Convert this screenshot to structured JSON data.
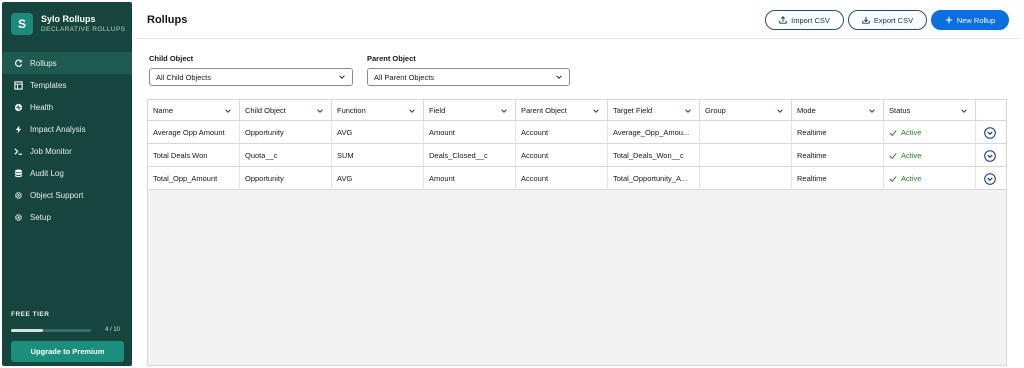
{
  "brand": {
    "logo_letter": "S",
    "name": "Sylo Rollups",
    "subtitle": "DECLARATIVE ROLLUPS"
  },
  "sidebar": {
    "items": [
      {
        "label": "Rollups",
        "icon": "refresh-icon",
        "active": true
      },
      {
        "label": "Templates",
        "icon": "template-icon",
        "active": false
      },
      {
        "label": "Health",
        "icon": "health-icon",
        "active": false
      },
      {
        "label": "Impact Analysis",
        "icon": "bolt-icon",
        "active": false
      },
      {
        "label": "Job Monitor",
        "icon": "terminal-icon",
        "active": false
      },
      {
        "label": "Audit Log",
        "icon": "database-icon",
        "active": false
      },
      {
        "label": "Object Support",
        "icon": "gear-icon",
        "active": false
      },
      {
        "label": "Setup",
        "icon": "settings-icon",
        "active": false
      }
    ],
    "tier_label": "FREE TIER",
    "tier_progress": 0.4,
    "tier_count": "4 / 10",
    "upgrade_label": "Upgrade to Premium"
  },
  "header": {
    "title": "Rollups",
    "import_label": "Import CSV",
    "export_label": "Export CSV",
    "new_label": "New Rollup"
  },
  "filters": {
    "child_label": "Child Object",
    "child_value": "All Child Objects",
    "parent_label": "Parent Object",
    "parent_value": "All Parent Objects"
  },
  "table": {
    "columns": [
      "Name",
      "Child Object",
      "Function",
      "Field",
      "Parent Object",
      "Target Field",
      "Group",
      "Mode",
      "Status"
    ],
    "rows": [
      [
        "Average Opp Amount",
        "Opportunity",
        "AVG",
        "Amount",
        "Account",
        "Average_Opp_Amou...",
        "",
        "Realtime",
        "Active"
      ],
      [
        "Total Deals Won",
        "Quota__c",
        "SUM",
        "Deals_Closed__c",
        "Account",
        "Total_Deals_Won__c",
        "",
        "Realtime",
        "Active"
      ],
      [
        "Total_Opp_Amount",
        "Opportunity",
        "AVG",
        "Amount",
        "Account",
        "Total_Opportunity_A...",
        "",
        "Realtime",
        "Active"
      ]
    ]
  },
  "colors": {
    "sidebar_bg": "#16453e",
    "active_item": "#1f5a51",
    "primary": "#0b6fe0",
    "status_active": "#2e7d32"
  }
}
